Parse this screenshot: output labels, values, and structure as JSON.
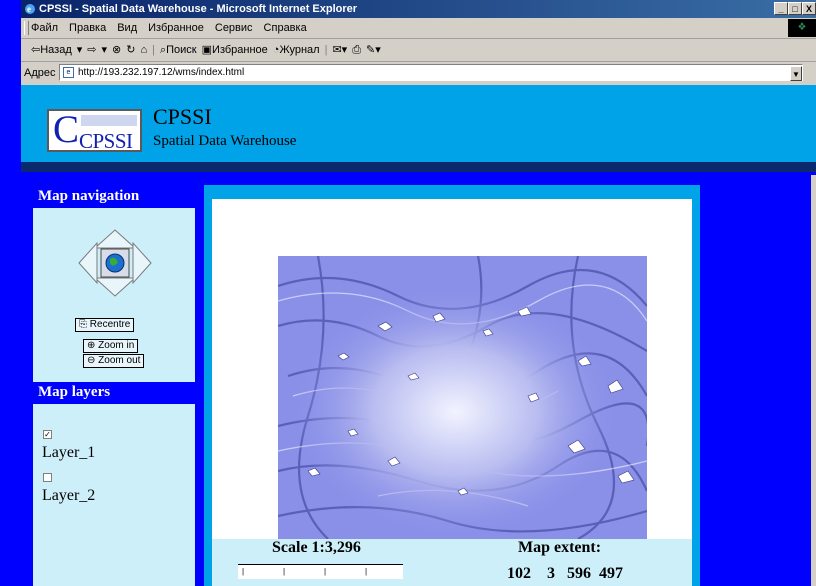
{
  "window": {
    "title": "CPSSI - Spatial Data Warehouse - Microsoft Internet Explorer",
    "controls": [
      "_",
      "□",
      "X"
    ]
  },
  "menu": {
    "items": [
      "Файл",
      "Правка",
      "Вид",
      "Избранное",
      "Сервис",
      "Справка"
    ]
  },
  "toolbar": {
    "back": "⇦Назад",
    "forward": "⇨",
    "search": "Поиск",
    "favorites": "Избранное",
    "history": "Журнал"
  },
  "address": {
    "label": "Адрес",
    "url": "http://193.232.197.12/wms/index.html"
  },
  "page": {
    "logo_text": "CPSSI",
    "name": "CPSSI",
    "subtitle": "Spatial Data Warehouse"
  },
  "sidebar": {
    "nav_title": "Map navigation",
    "recentre": "Recentre",
    "zoom_in": "Zoom in",
    "zoom_out": "Zoom out",
    "layers_title": "Map layers",
    "layers": [
      {
        "label": "Layer_1",
        "checked": true
      },
      {
        "label": "Layer_2",
        "checked": false
      }
    ]
  },
  "map": {
    "scale": "Scale 1:3,296",
    "extent_label": "Map extent:",
    "extent_values": "102    3   596  497"
  },
  "colors": {
    "page_bg": "#0000ff",
    "header_bg": "#00a2e8",
    "panel_bg": "#cdeffa",
    "map_tint": "#8a90e8"
  }
}
